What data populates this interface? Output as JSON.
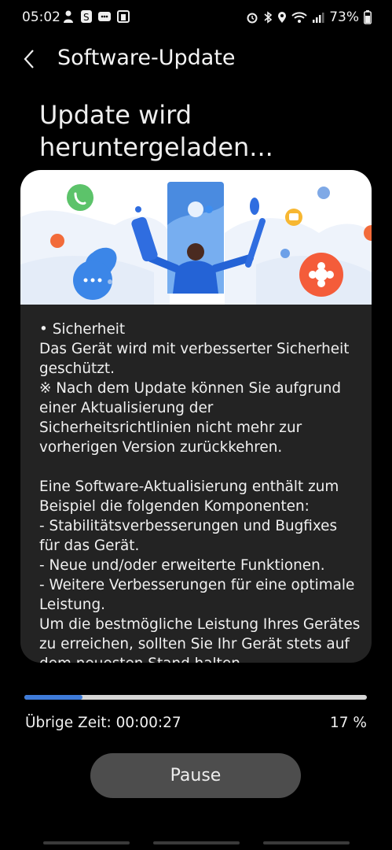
{
  "status_bar": {
    "time": "05:02",
    "left_icons": [
      "person-alert-icon",
      "app-s-icon",
      "app-more-icon",
      "calendar-icon"
    ],
    "right_icons": [
      "alarm-icon",
      "bluetooth-icon",
      "location-icon",
      "wifi-icon",
      "signal-icon"
    ],
    "battery_text": "73%"
  },
  "header": {
    "title": "Software-Update",
    "back_icon": "chevron-left-icon"
  },
  "headline": "Update wird heruntergeladen...",
  "card": {
    "notes": "• Sicherheit\nDas Gerät wird mit verbesserter Sicherheit geschützt.\n※ Nach dem Update können Sie aufgrund einer Aktualisierung der Sicherheitsrichtlinien nicht mehr zur vorherigen Version zurückkehren.\n\nEine Software-Aktualisierung enthält zum Beispiel die folgenden Komponenten:\n - Stabilitätsverbesserungen und Bugfixes für das Gerät.\n - Neue und/oder erweiterte Funktionen.\n - Weitere Verbesserungen für eine optimale Leistung.\nUm die bestmögliche Leistung Ihres Gerätes zu erreichen, sollten Sie Ihr Gerät stets auf dem neuesten Stand halten."
  },
  "progress": {
    "percent_value": 17,
    "remaining_label": "Übrige Zeit: 00:00:27",
    "percent_label": "17 %"
  },
  "actions": {
    "pause_label": "Pause"
  },
  "colors": {
    "accent": "#3e7bd9",
    "card_bg": "#232323",
    "button_bg": "#4d4d4d"
  }
}
